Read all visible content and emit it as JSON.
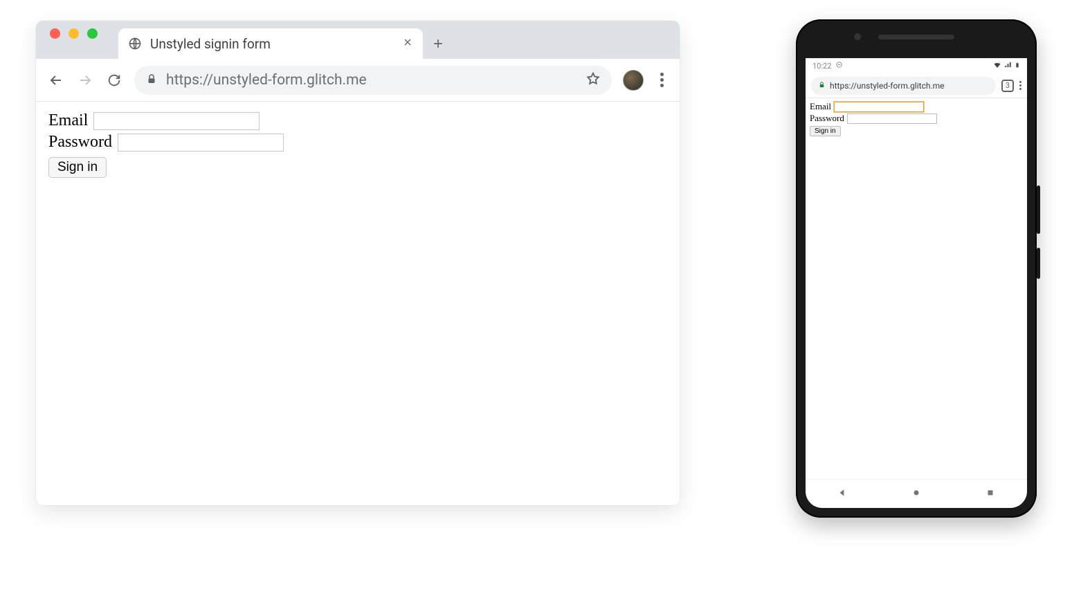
{
  "desktop": {
    "tab_title": "Unstyled signin form",
    "url": "https://unstyled-form.glitch.me",
    "form": {
      "email_label": "Email",
      "password_label": "Password",
      "signin_label": "Sign in"
    }
  },
  "mobile": {
    "status_time": "10:22",
    "url_display": "https://unstyled-form.glitch.me",
    "tab_count": "3",
    "form": {
      "email_label": "Email",
      "password_label": "Password",
      "signin_label": "Sign in"
    }
  }
}
